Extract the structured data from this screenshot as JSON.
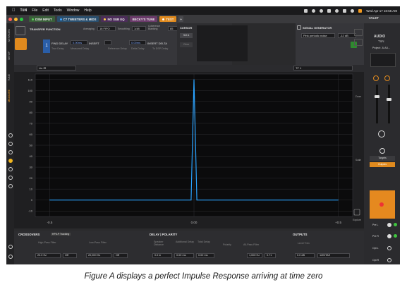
{
  "menubar": {
    "app": "TüN",
    "items": [
      "File",
      "Edit",
      "Tools",
      "Window",
      "Help"
    ],
    "clock": "Wed Apr 17  10:56 AM"
  },
  "tabs": [
    {
      "label": "DSM INPUT",
      "color": "#3d8f3d"
    },
    {
      "label": "C7 TWEETERS & MIDS",
      "color": "#2f77b8"
    },
    {
      "label": "NO SUB EQ",
      "color": "#6b2d80"
    },
    {
      "label": "BECKY'S TUNE",
      "color": "#7b3a7b"
    },
    {
      "label": "TEST",
      "color": "#e08a1e"
    }
  ],
  "valet_label": "VALET",
  "left_rail": [
    "NETWORK",
    "SETUP",
    "TUNE",
    "MEASURE"
  ],
  "transfer": {
    "title": "TRANSFER FUNCTION",
    "averaging_label": "Averaging",
    "averaging_value": "16 FIFO",
    "smoothing_label": "Smoothing",
    "smoothing_value": "1/48",
    "coherence_label": "Coherence Blanking",
    "coherence_value": "85",
    "find_delay": "FIND DELAY",
    "delay_value": "0.00ms",
    "insert_label": "INSERT",
    "true_delay": "True Delay",
    "measured_delay": "Measured Delay",
    "ref_delay": "Reference Delay",
    "delta_delay": "Delta Delay",
    "ref_value": "0.00ms",
    "insert_delta": "INSERT DELTA",
    "to_dsp": "To DSP Delay",
    "channel": "1"
  },
  "cursor_panel": {
    "title": "CURSOR",
    "set_a": "Set A",
    "clear": "Clear"
  },
  "siggen": {
    "title": "SIGNAL GENERATOR",
    "noise": "Pink periodic noise",
    "level": "-12 dB"
  },
  "brand": {
    "logo": "AUDIO",
    "sub": "TüN",
    "project": "Project: JL AU..."
  },
  "plot": {
    "left_select": "Lin IR",
    "right_select": "TF 1",
    "explore": "Explore"
  },
  "right_icons": {
    "zoom": "Zoom",
    "scale": "Scale"
  },
  "targets": {
    "targets": "Targets",
    "outputs": "Outputs"
  },
  "preamp": [
    "Pre L",
    "Pre R",
    "Opt L",
    "Opt R"
  ],
  "bottom": {
    "crossovers": "CROSSOVERS",
    "xo_chip": "HP/LP Tracking",
    "hp_filter": "High-Pass Filter",
    "lp_filter": "Low-Pass Filter",
    "hp_freq": "20.0 Hz",
    "hp_slope": "Off",
    "lp_freq": "20,000 Hz",
    "lp_slope": "Off",
    "delay_polarity": "DELAY | POLARITY",
    "speaker_distance": "Speaker Distance",
    "additional_delay": "Additional Delay",
    "total_delay": "Total Delay",
    "polarity": "Polarity",
    "allpass": "All-Pass Filter",
    "dist_val": "0.0 in",
    "add_val": "0.00 ms",
    "total_val": "0.00 ms",
    "ap_freq": "1,000 Hz",
    "ap_q": "0.71",
    "outputs": "OUTPUTS",
    "level_trim": "Level Trim",
    "trim_val": "0.0 dB",
    "out_name": "12INTAE"
  },
  "chart_data": {
    "type": "line",
    "title": "",
    "xlabel": "",
    "ylabel": "",
    "x": [
      -0.5,
      -0.01,
      0.0,
      0.01,
      0.5
    ],
    "y": [
      0,
      0,
      110,
      0,
      0
    ],
    "series": [
      {
        "values": [
          0,
          0,
          110,
          0,
          0
        ],
        "color": "#2aa3ff"
      }
    ],
    "xlim": [
      -0.55,
      0.55
    ],
    "ylim": [
      -15,
      115
    ],
    "x_ticks": [
      -0.5,
      0.0,
      0.5
    ],
    "x_tick_labels": [
      "-0.5",
      "0.00",
      "+0.5"
    ],
    "y_ticks": [
      110,
      100,
      90,
      80,
      70,
      60,
      50,
      40,
      30,
      20,
      10,
      0,
      -10
    ],
    "grid": true,
    "legend": "none"
  },
  "caption": "Figure A displays a perfect Impulse Response arriving at time zero"
}
